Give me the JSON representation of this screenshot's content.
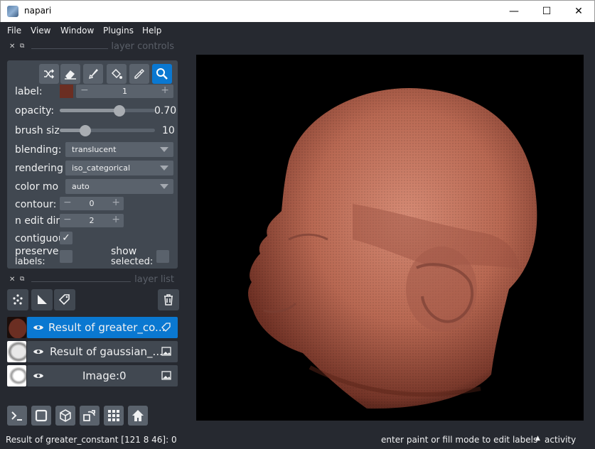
{
  "window": {
    "title": "napari",
    "minimize": "—",
    "maximize": "☐",
    "close": "✕"
  },
  "menu": [
    "File",
    "View",
    "Window",
    "Plugins",
    "Help"
  ],
  "layer_controls": {
    "header": "layer controls",
    "label_label": "label:",
    "label_value": "1",
    "label_color": "#6b2e22",
    "opacity_label": "opacity:",
    "opacity_value": "0.70",
    "brush_label": "brush siz",
    "brush_value": "10",
    "blending_label": "blending:",
    "blending_value": "translucent",
    "rendering_label": "rendering",
    "rendering_value": "iso_categorical",
    "colormode_label": "color mo",
    "colormode_value": "auto",
    "contour_label": "contour:",
    "contour_value": "0",
    "ndim_label": "n edit din",
    "ndim_value": "2",
    "contiguous_label": "contiguou",
    "preserve_label_1": "preserve",
    "preserve_label_2": "labels:",
    "show_label_1": "show",
    "show_label_2": "selected:",
    "stepper_minus": "−",
    "stepper_plus": "+",
    "check": "✓"
  },
  "layer_list": {
    "header": "layer list",
    "layers": [
      {
        "name": "Result of greater_co...",
        "selected": true,
        "type": "labels"
      },
      {
        "name": "Result of gaussian_...",
        "selected": false,
        "type": "image"
      },
      {
        "name": "Image:0",
        "selected": false,
        "type": "image"
      }
    ]
  },
  "status": {
    "left": "Result of greater_constant [121  8  46]: 0",
    "hint": "enter paint or fill mode to edit labels",
    "activity": "activity",
    "activity_arrow": "▲"
  },
  "colors": {
    "accent": "#0a78d1",
    "background": "#262930",
    "panel": "#414851",
    "volume": "#c07060"
  }
}
